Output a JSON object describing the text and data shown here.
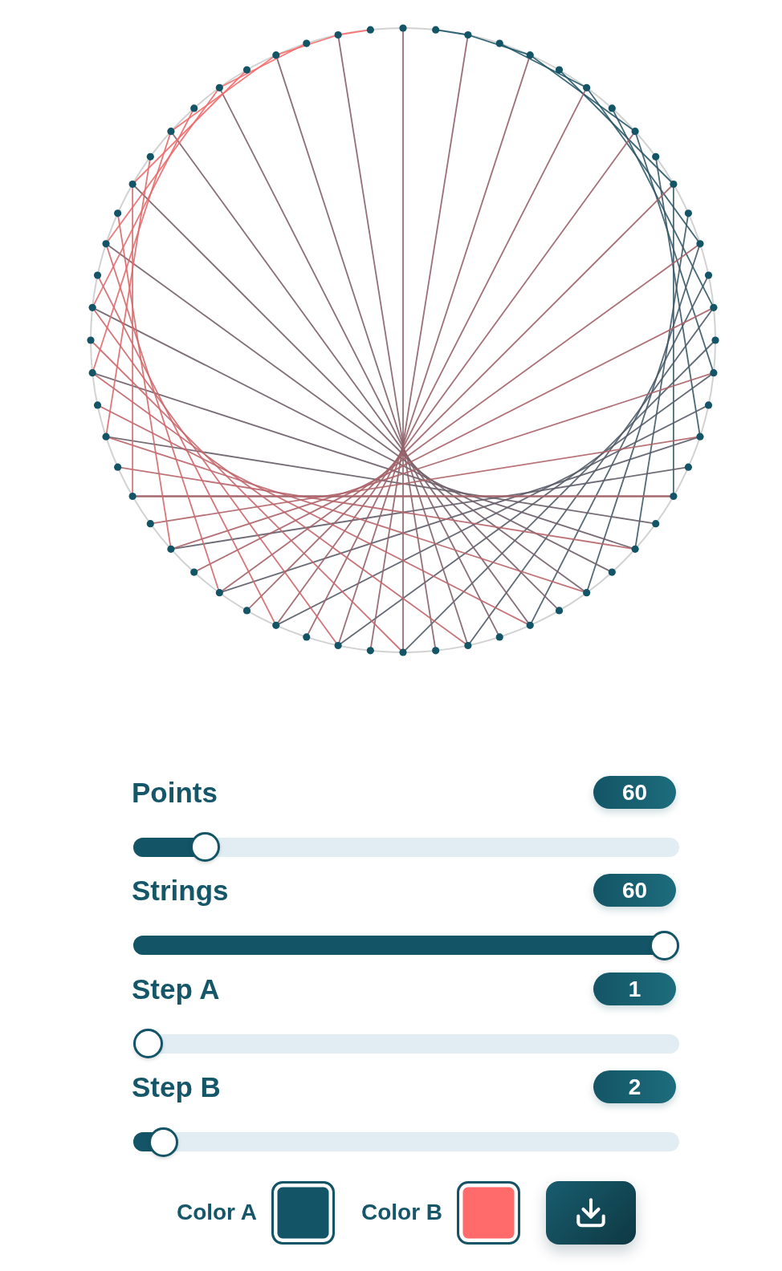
{
  "sliders": [
    {
      "label": "Points",
      "value": "60",
      "level": 0.11
    },
    {
      "label": "Strings",
      "value": "60",
      "level": 1
    },
    {
      "label": "Step A",
      "value": "1",
      "level": 0
    },
    {
      "label": "Step B",
      "value": "2",
      "level": 0.03
    }
  ],
  "colors": [
    {
      "label": "Color A",
      "color": "#135566"
    },
    {
      "label": "Color B",
      "color": "#ff6b6b"
    }
  ]
}
